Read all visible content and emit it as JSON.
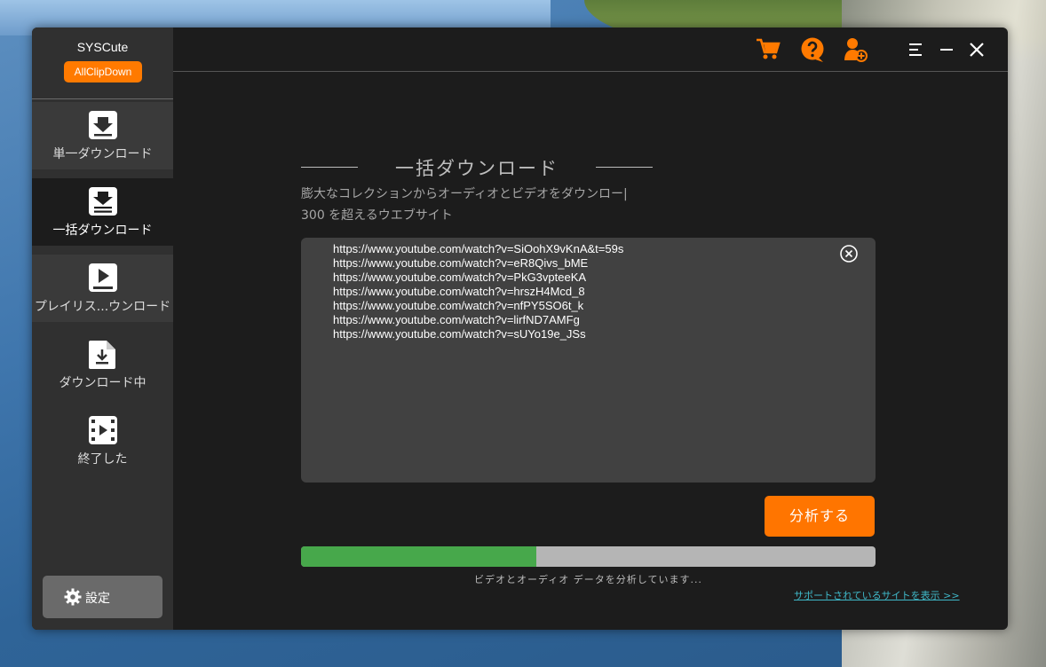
{
  "app": {
    "brand_name": "SYSCute",
    "brand_badge": "AllClipDown",
    "accent_color": "#ff7a00",
    "progress_color": "#47a84b",
    "link_color": "#3fb8c8"
  },
  "sidebar": {
    "items": [
      {
        "label": "単一ダウンロード",
        "icon": "single-download-icon",
        "active": false
      },
      {
        "label": "一括ダウンロード",
        "icon": "batch-download-icon",
        "active": true
      },
      {
        "label": "プレイリス...ウンロード",
        "icon": "playlist-play-icon",
        "active": false
      },
      {
        "label": "ダウンロード中",
        "icon": "downloading-file-icon",
        "active": false
      },
      {
        "label": "終了した",
        "icon": "film-icon",
        "active": false
      }
    ],
    "settings_label": "設定"
  },
  "topbar": {
    "icons": [
      "cart-icon",
      "help-icon",
      "user-add-icon",
      "menu-icon",
      "minimize-icon",
      "close-icon"
    ]
  },
  "main": {
    "title": "一括ダウンロード",
    "description_line1": "膨大なコレクションからオーディオとビデオをダウンロー|",
    "description_line2": "300 を超えるウエブサイト",
    "urls": [
      "https://www.youtube.com/watch?v=SiOohX9vKnA&t=59s",
      "https://www.youtube.com/watch?v=eR8Qivs_bME",
      "https://www.youtube.com/watch?v=PkG3vpteeKA",
      "https://www.youtube.com/watch?v=hrszH4Mcd_8",
      "https://www.youtube.com/watch?v=nfPY5SO6t_k",
      "https://www.youtube.com/watch?v=lirfND7AMFg",
      "https://www.youtube.com/watch?v=sUYo19e_JSs"
    ],
    "analyze_label": "分析する",
    "progress_percent": 41,
    "status_text": "ビデオとオーディオ データを分析しています...",
    "support_link": "サポートされているサイトを表示 >>"
  }
}
